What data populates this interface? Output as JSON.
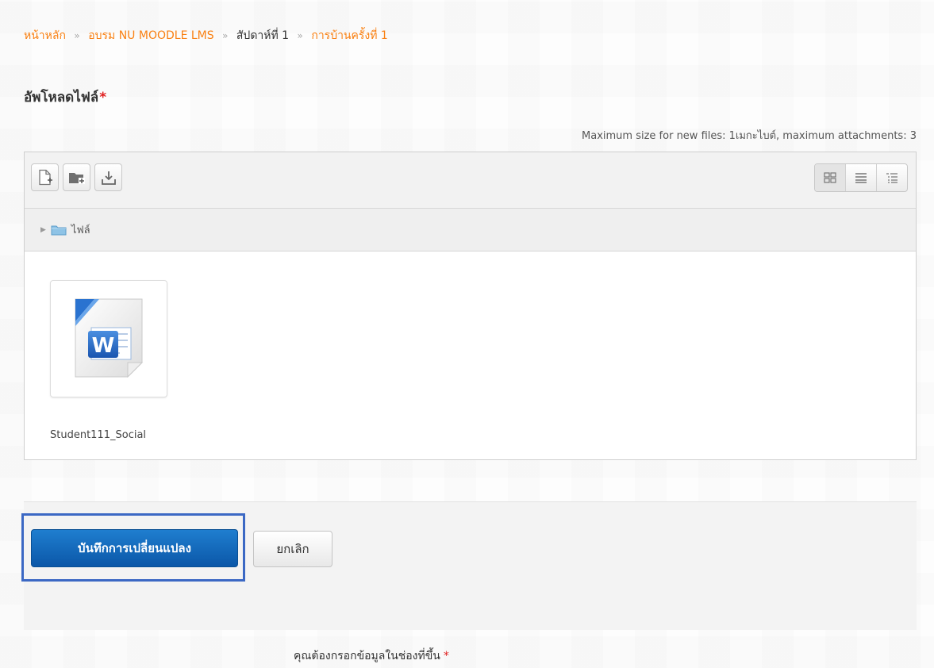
{
  "breadcrumb": {
    "home": "หน้าหลัก",
    "course": "อบรม NU MOODLE LMS",
    "section": "สัปดาห์ที่ 1",
    "activity": "การบ้านครั้งที่ 1",
    "separator": "»"
  },
  "upload": {
    "label": "อัพโหลดไฟล์",
    "required_mark": "*",
    "limits": "Maximum size for new files: 1เมกะไบต์, maximum attachments: 3"
  },
  "filemanager": {
    "toolbar": {
      "add_file_icon": "add-file-icon",
      "create_folder_icon": "create-folder-icon",
      "download_icon": "download-icon"
    },
    "views": [
      "view-icons-icon",
      "view-details-icon",
      "view-tree-icon"
    ],
    "active_view": 0,
    "path": {
      "folder_label": "ไฟล์"
    },
    "files": [
      {
        "name": "Student111_Social",
        "icon": "word-document-icon"
      }
    ]
  },
  "actions": {
    "save_label": "บันทึกการเปลี่ยนแปลง",
    "cancel_label": "ยกเลิก"
  },
  "footer": {
    "required_note": "คุณต้องกรอกข้อมูลในช่องที่ขึ้น",
    "required_mark": "*"
  },
  "colors": {
    "link": "#f98012",
    "primary_button": "#0b57a8",
    "highlight": "#3b68c4",
    "required": "#e02020"
  }
}
